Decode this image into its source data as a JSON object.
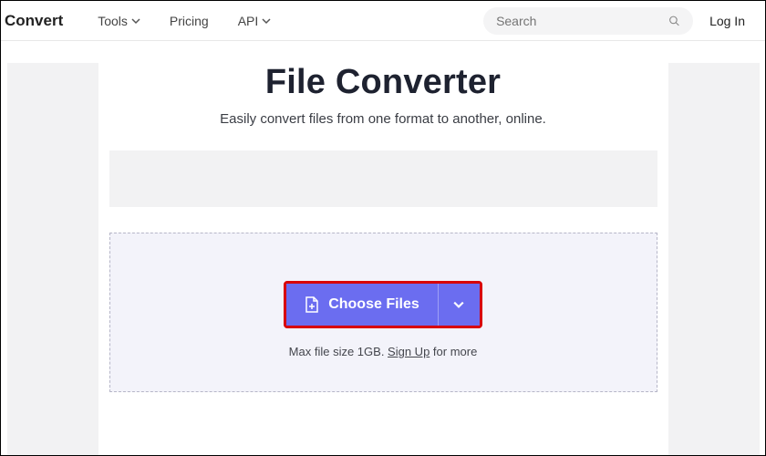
{
  "header": {
    "logo": "Convert",
    "nav": {
      "tools": "Tools",
      "pricing": "Pricing",
      "api": "API"
    },
    "search_placeholder": "Search",
    "login": "Log In"
  },
  "main": {
    "title": "File Converter",
    "subtitle": "Easily convert files from one format to another, online.",
    "choose_label": "Choose Files",
    "max_text_before": "Max file size 1GB. ",
    "signup_text": "Sign Up",
    "max_text_after": " for more"
  }
}
